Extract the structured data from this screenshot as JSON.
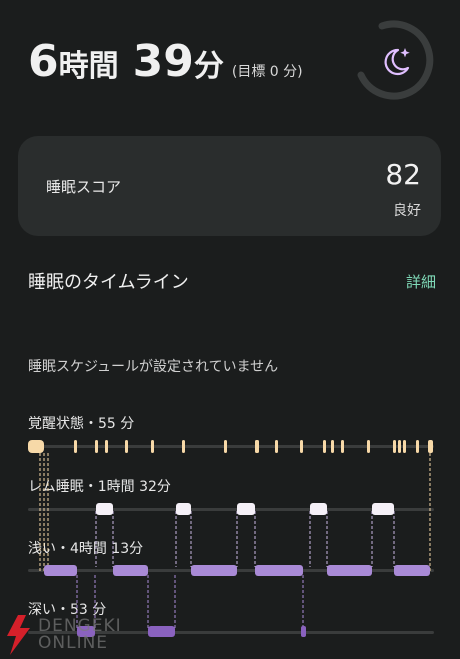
{
  "summary": {
    "hours_value": "6",
    "hours_unit": "時間",
    "minutes_value": "39",
    "minutes_unit": "分",
    "goal_text": "(目標 0 分)",
    "icon": "moon-sparkle-icon"
  },
  "score_card": {
    "label": "睡眠スコア",
    "score": "82",
    "quality": "良好"
  },
  "timeline_section": {
    "title": "睡眠のタイムライン",
    "details_label": "詳細",
    "schedule_message": "睡眠スケジュールが設定されていません"
  },
  "stages": [
    {
      "label": "覚醒状態・55 分"
    },
    {
      "label": "レム睡眠・1時間 32分"
    },
    {
      "label": "浅い・4時間 13分"
    },
    {
      "label": "深い・53 分"
    }
  ],
  "colors": {
    "awake": "#f7d9a8",
    "rem": "#f5f0f7",
    "light": "#a98ad6",
    "deep": "#8a62bf",
    "accent_link": "#7fd9b7",
    "icon": "#e0bfff"
  },
  "watermark": {
    "line1": "DENGEKI",
    "line2": "ONLINE"
  }
}
